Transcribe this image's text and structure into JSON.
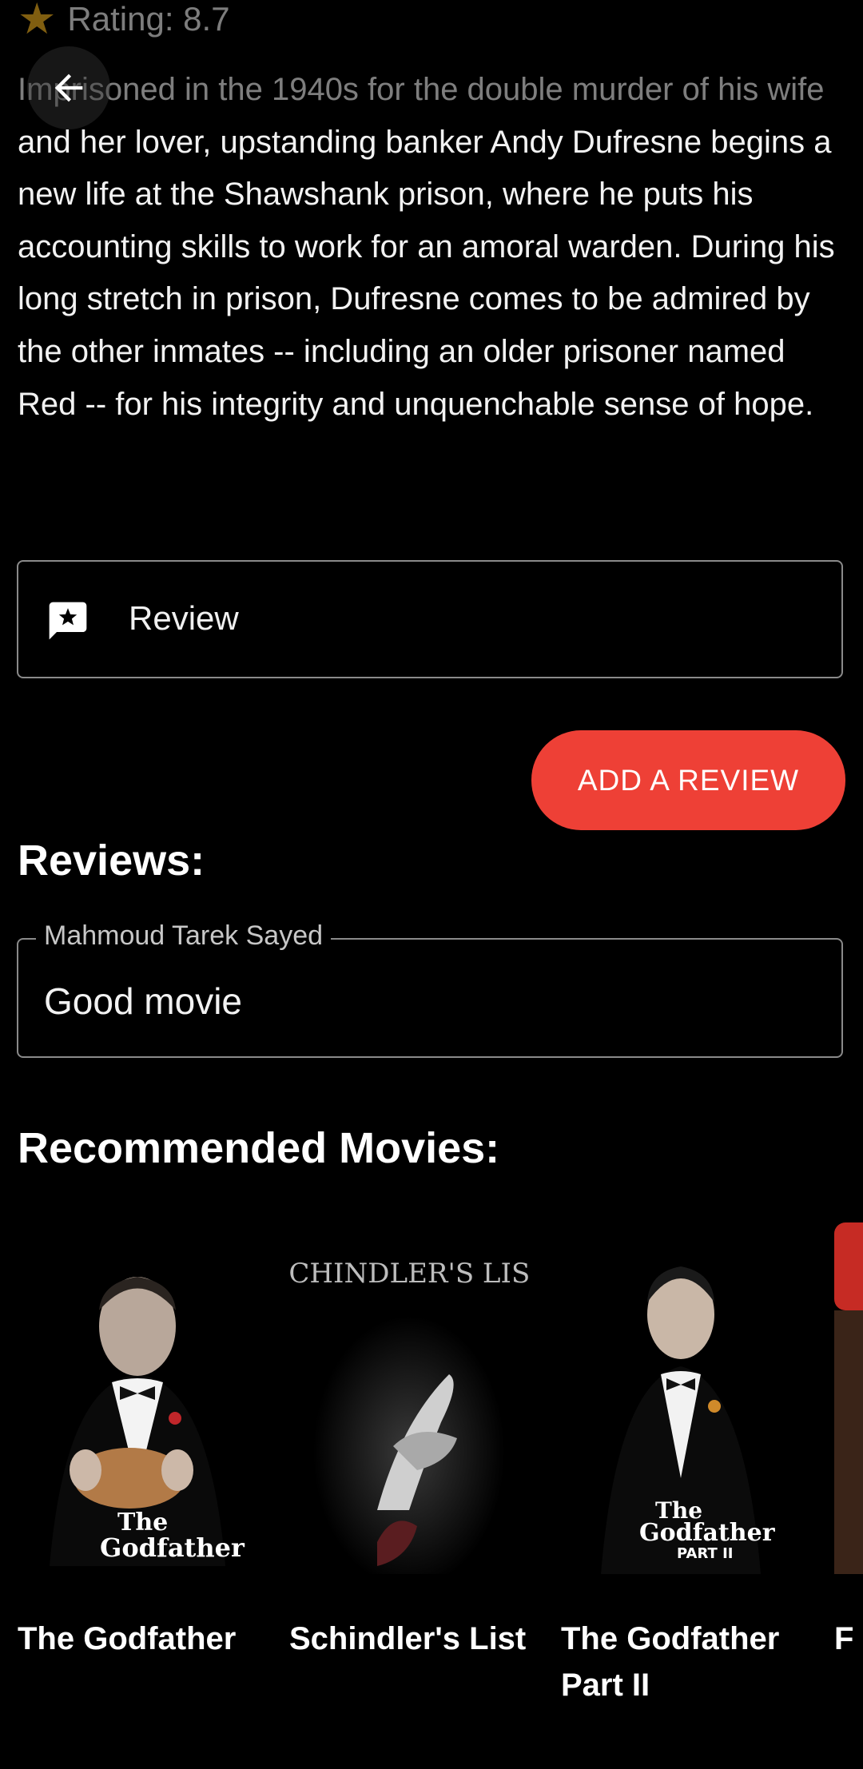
{
  "header": {
    "rating_text": "Rating: 8.7",
    "back_icon": "arrow-back-icon"
  },
  "overview": "Imprisoned in the 1940s for the double murder of his wife and her lover, upstanding banker Andy Dufresne begins a new life at the Shawshank prison, where he puts his accounting skills to work for an amoral warden. During his long stretch in prison, Dufresne comes to be admired by the other inmates -- including an older prisoner named Red -- for his integrity and unquenchable sense of hope.",
  "review_input": {
    "label": "Review",
    "icon": "rate-review-icon"
  },
  "add_review_button": "ADD A REVIEW",
  "reviews": {
    "title": "Reviews:",
    "items": [
      {
        "author": "Mahmoud Tarek Sayed",
        "text": "Good movie"
      }
    ]
  },
  "recommended": {
    "title": "Recommended Movies:",
    "movies": [
      {
        "title": "The Godfather",
        "poster_text_1": "The",
        "poster_text_2": "Godfather"
      },
      {
        "title": "Schindler's List",
        "poster_text_1": "SCHINDLER'S LIST"
      },
      {
        "title": "The Godfather Part II",
        "poster_text_1": "The",
        "poster_text_2": "Godfather",
        "poster_text_3": "PART II"
      },
      {
        "title": "F"
      }
    ]
  },
  "colors": {
    "accent": "#ee4036",
    "star": "#f5b51f",
    "background": "#000000",
    "border": "#8a8a8a"
  }
}
